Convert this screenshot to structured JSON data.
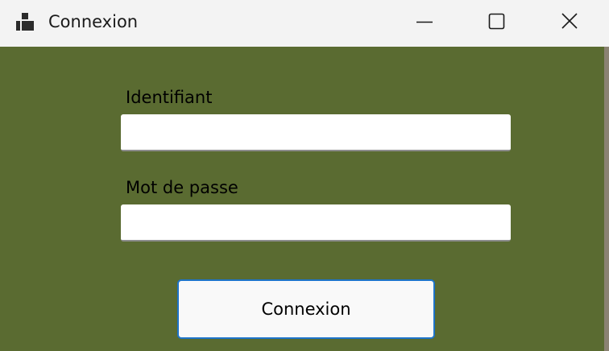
{
  "window": {
    "title": "Connexion",
    "icon": "app-window-icon",
    "controls": {
      "minimize": "minimize-icon",
      "maximize": "maximize-icon",
      "close": "close-icon"
    }
  },
  "form": {
    "username_label": "Identifiant",
    "username_value": "",
    "password_label": "Mot de passe",
    "password_value": "",
    "submit_label": "Connexion"
  },
  "colors": {
    "titlebar_background": "#f3f3f3",
    "form_background": "#5a6b31",
    "input_background": "#ffffff",
    "button_background": "#f9f9f9",
    "button_focus_border": "#1d74c9"
  }
}
